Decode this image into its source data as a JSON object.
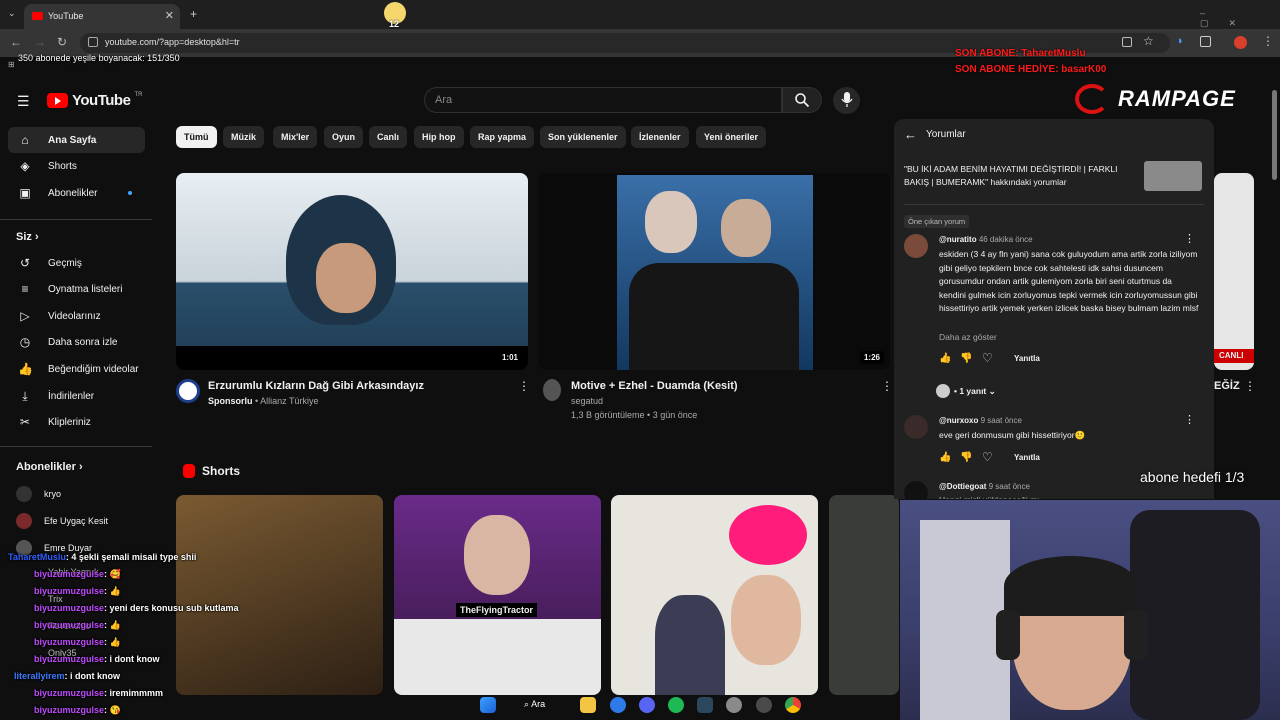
{
  "browser": {
    "tab_title": "YouTube",
    "url": "youtube.com/?app=desktop&hl=tr"
  },
  "overlay": {
    "goal_line": "350 abonede yeşile boyanacak: 151/350",
    "last_sub": "SON ABONE: TaharetMuslu",
    "last_gift": "SON ABONE HEDİYE: basarK00",
    "brand": "RAMPAGE",
    "sub_goal": "abone hedefi 1/3",
    "badge_num": "12"
  },
  "header": {
    "logo": "YouTube",
    "logo_country": "TR",
    "search_placeholder": "Ara"
  },
  "sidebar": {
    "main": [
      {
        "label": "Ana Sayfa",
        "icon": "home-icon"
      },
      {
        "label": "Shorts",
        "icon": "shorts-icon"
      },
      {
        "label": "Abonelikler",
        "icon": "subscriptions-icon"
      }
    ],
    "you_heading": "Siz",
    "you": [
      {
        "label": "Geçmiş",
        "icon": "history-icon"
      },
      {
        "label": "Oynatma listeleri",
        "icon": "playlists-icon"
      },
      {
        "label": "Videolarınız",
        "icon": "your-videos-icon"
      },
      {
        "label": "Daha sonra izle",
        "icon": "watch-later-icon"
      },
      {
        "label": "Beğendiğim videolar",
        "icon": "liked-icon"
      },
      {
        "label": "İndirilenler",
        "icon": "download-icon"
      },
      {
        "label": "Klipleriniz",
        "icon": "clips-icon"
      }
    ],
    "subs_heading": "Abonelikler",
    "channels": [
      "kryo",
      "Efe Uygaç Kesit",
      "Emre Duyar",
      "Yabir Yagruk",
      "Trix",
      "Revenchio",
      "Only35"
    ]
  },
  "chips": [
    "Tümü",
    "Müzik",
    "Mix'ler",
    "Oyun",
    "Canlı",
    "Hip hop",
    "Rap yapma",
    "Son yüklenenler",
    "İzlenenler",
    "Yeni öneriler"
  ],
  "videos": [
    {
      "title": "Erzurumlu Kızların Dağ Gibi Arkasındayız",
      "sponsor": "Sponsorlu",
      "channel": "Allianz Türkiye",
      "duration": "1:01"
    },
    {
      "title": "Motive + Ezhel - Duamda (Kesit)",
      "channel": "segatud",
      "meta": "1,3 B görüntüleme • 3 gün önce",
      "duration": "1:26"
    },
    {
      "title_partial": "EĞİZ",
      "live": "CANLI"
    }
  ],
  "shorts_heading": "Shorts",
  "shorts_overlay_text": "TheFlyingTractor",
  "comments": {
    "title": "Yorumlar",
    "video_ref": "\"BU İKİ ADAM BENİM HAYATIMI DEĞİŞTİRDİ! | FARKLI BAKIŞ | BUMERAMK\" hakkındaki yorumlar",
    "pinned_label": "Öne çıkan yorum",
    "items": [
      {
        "user": "@nuratito",
        "time": "46 dakika önce",
        "text": "eskiden (3 4 ay fln yani) sana cok guluyodum ama artik zorla iziliyom gibi geliyo tepkilern bnce cok sahtelesti idk sahsi dusuncem gorusumdur ondan artik gulemiyom zorla biri seni oturtmus da kendini gulmek icin zorluyomus tepki vermek icin zorluyomussun gibi hissettiriyo artik yemek yerken izlicek baska bisey bulmam lazim mlsf",
        "more": "Daha az göster",
        "reply": "Yanıtla",
        "replies": "• 1 yanıt"
      },
      {
        "user": "@nurxoxo",
        "time": "9 saat önce",
        "text": "eve geri donmusum gibi hissettiriyor🙂",
        "reply": "Yanıtla"
      },
      {
        "user": "@Dottiegoat",
        "time": "9 saat önce",
        "text": "Hangi misli yükleneceği mı..."
      }
    ]
  },
  "chat": [
    {
      "user": "TaharetMuslu",
      "msg": ": 4 şekli şemali misali type shii"
    },
    {
      "user": "biyuzumuzgulse",
      "msg": ": 🥰"
    },
    {
      "user": "biyuzumuzgulse",
      "msg": ": 👍"
    },
    {
      "user": "biyuzumuzgulse",
      "msg": ": yeni ders konusu sub kutlama"
    },
    {
      "user": "biyuzumuzgulse",
      "msg": ": 👍"
    },
    {
      "user": "biyuzumuzgulse",
      "msg": ": 👍"
    },
    {
      "user": "biyuzumuzgulse",
      "msg": ": i dont know"
    },
    {
      "user": "literallyirem",
      "msg": ": i dont know"
    },
    {
      "user": "biyuzumuzgulse",
      "msg": ": iremimmmm"
    },
    {
      "user": "biyuzumuzgulse",
      "msg": ": 😘"
    }
  ],
  "taskbar": {
    "search": "Ara"
  },
  "colors": {
    "accent": "#ff0000",
    "bg": "#0f0f0f",
    "chip": "#272727",
    "overlay_red": "#ff1a1a"
  }
}
